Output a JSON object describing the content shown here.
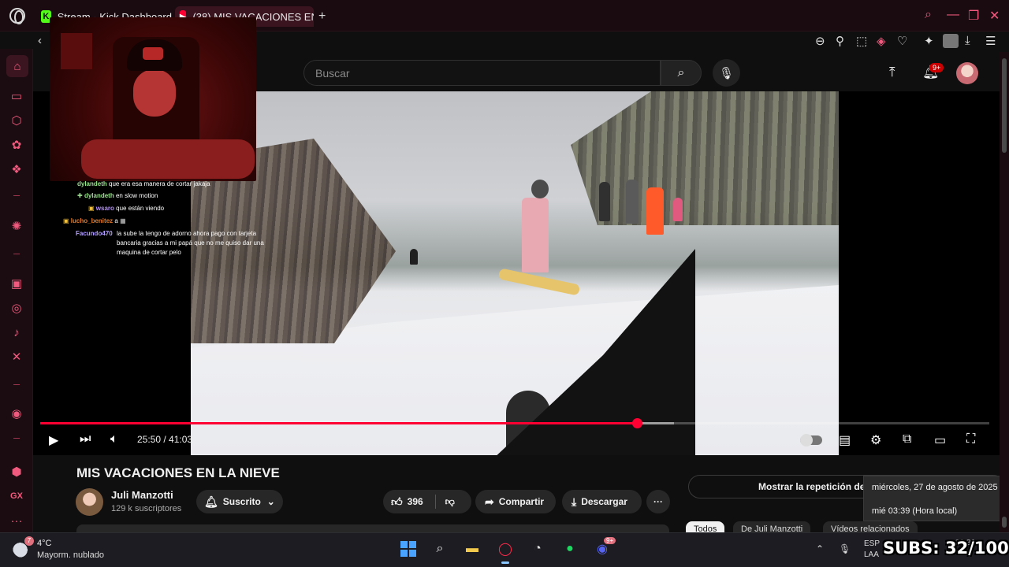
{
  "browser": {
    "tabs": [
      {
        "label": "Stream - Kick Dashboard",
        "icon": "kick-icon"
      },
      {
        "label": "(38) MIS VACACIONES EN",
        "icon": "youtube-icon"
      }
    ],
    "new_tab": "+",
    "window_controls": [
      "search-icon",
      "minimize-icon",
      "restore-icon",
      "close-icon"
    ],
    "toolbar_icons": [
      "back-icon",
      "zoom-out-icon",
      "pin-icon",
      "screenshot-icon",
      "pocket-icon",
      "heart-icon",
      "extensions-icon",
      "profile-icon",
      "download-icon",
      "menu-icon"
    ],
    "accent_color": "#f05a7e"
  },
  "sidebar": {
    "items": [
      "home-icon",
      "gamepad-icon",
      "aria-icon",
      "chatgpt-icon",
      "cube-icon",
      "openai-icon",
      "twitch-icon",
      "instagram-icon",
      "tiktok-icon",
      "x-icon",
      "record-icon",
      "settings-icon"
    ],
    "gx_label": "GX",
    "more_label": "···"
  },
  "youtube": {
    "search_placeholder": "Buscar",
    "notification_count": "9+",
    "video": {
      "current_time": "25:50",
      "duration": "41:03",
      "time_display": "25:50 / 41:03",
      "progress_fraction": 0.629,
      "buffered_fraction": 0.668
    },
    "title": "MIS VACACIONES EN LA NIEVE",
    "channel": {
      "name": "Juli Manzotti",
      "subscribers": "129 k suscriptores"
    },
    "subscribed_label": "Suscrito",
    "likes": "396",
    "share_label": "Compartir",
    "download_label": "Descargar",
    "more_label": "···",
    "replay_label": "Mostrar la repetición del c",
    "chips": [
      "Todos",
      "De Juli Manzotti",
      "Vídeos relacionados"
    ]
  },
  "chat": {
    "lines": [
      {
        "user": "dylandeth",
        "message": "que era esa manera de cortar jakaja",
        "color": "#9be38f"
      },
      {
        "user": "dylandeth",
        "message": "en slow motion",
        "color": "#9be38f"
      },
      {
        "user": "wsaro",
        "message": "que están viendo",
        "color": "#b48cff"
      },
      {
        "user": "lucho_benitez",
        "message": "a",
        "color": "#e07a2b"
      },
      {
        "user": "Facundo470",
        "message": "la sube la tengo de adorno ahora pago con tarjeta bancaria gracias a mi papá que no me quiso dar una maquina de cortar pelo",
        "color": "#b4a0ff"
      }
    ]
  },
  "tooltip": {
    "date": "miércoles, 27 de agosto de 2025",
    "time": "mié 03:39 (Hora local)"
  },
  "taskbar": {
    "weather_temp": "4°C",
    "weather_desc": "Mayorm. nublado",
    "weather_badge": "7",
    "apps": [
      "windows-icon",
      "search-icon",
      "file-explorer-icon",
      "opera-gx-icon",
      "github-desktop-icon",
      "spotify-icon",
      "discord-icon"
    ],
    "discord_badge": "9+",
    "lang_top": "ESP",
    "lang_bottom": "LAA",
    "clock": "03:39",
    "overlay": "SUBS: 32/100"
  }
}
